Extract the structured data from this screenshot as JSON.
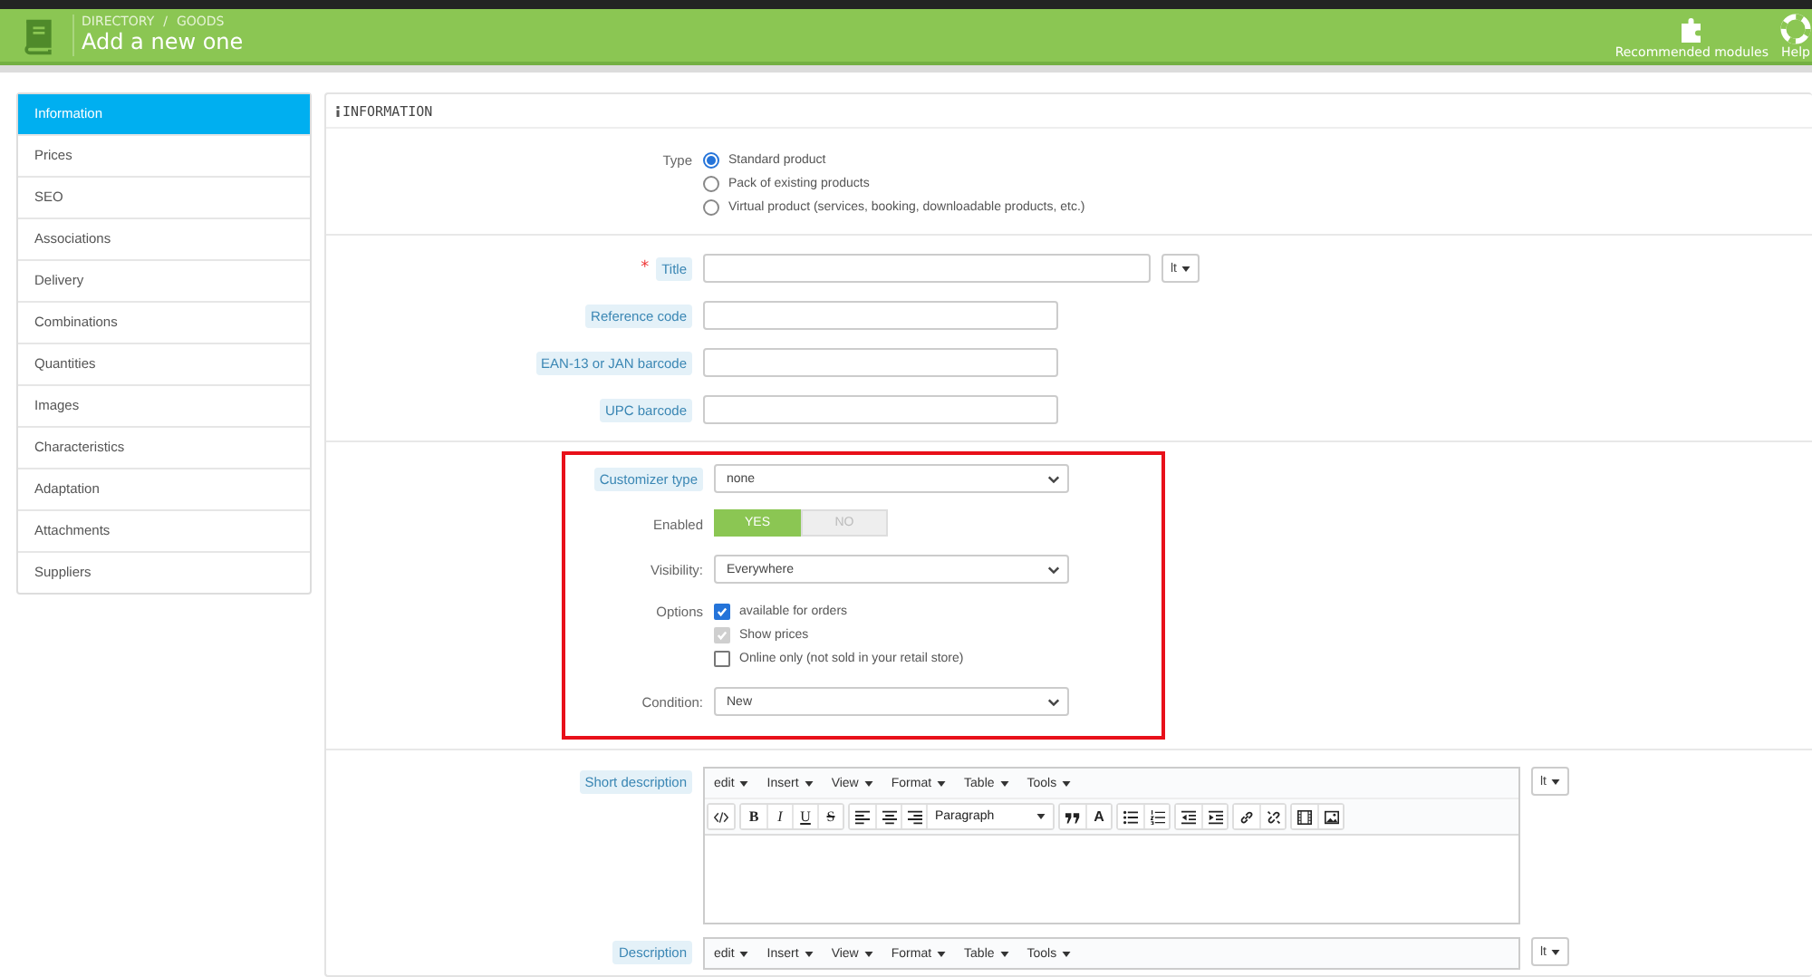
{
  "header": {
    "breadcrumb": [
      "DIRECTORY",
      "GOODS"
    ],
    "separator": "/",
    "title": "Add a new one",
    "actions": [
      {
        "label": "Recommended modules"
      },
      {
        "label": "Help"
      }
    ]
  },
  "sidebar": {
    "items": [
      {
        "label": "Information",
        "selected": true
      },
      {
        "label": "Prices",
        "selected": false
      },
      {
        "label": "SEO",
        "selected": false
      },
      {
        "label": "Associations",
        "selected": false
      },
      {
        "label": "Delivery",
        "selected": false
      },
      {
        "label": "Combinations",
        "selected": false
      },
      {
        "label": "Quantities",
        "selected": false
      },
      {
        "label": "Images",
        "selected": false
      },
      {
        "label": "Characteristics",
        "selected": false
      },
      {
        "label": "Adaptation",
        "selected": false
      },
      {
        "label": "Attachments",
        "selected": false
      },
      {
        "label": "Suppliers",
        "selected": false
      }
    ]
  },
  "panel": {
    "title": "INFORMATION",
    "sections": [
      {
        "highlighted": false,
        "rows": [
          {
            "kind": "radio",
            "label": "Type",
            "hint": false,
            "options": [
              {
                "label": "Standard product",
                "selected": true
              },
              {
                "label": "Pack of existing products",
                "selected": false
              },
              {
                "label": "Virtual product (services, booking, downloadable products, etc.)",
                "selected": false
              }
            ]
          }
        ]
      },
      {
        "highlighted": false,
        "rows": [
          {
            "kind": "input",
            "label": "Title",
            "marker": "*",
            "hint": true,
            "lang": "lt"
          },
          {
            "kind": "input",
            "label": "Reference code",
            "hint": true
          },
          {
            "kind": "input",
            "label": "EAN-13 or JAN barcode",
            "hint": true
          },
          {
            "kind": "input",
            "label": "UPC barcode",
            "hint": true
          }
        ]
      },
      {
        "highlighted": true,
        "rows": [
          {
            "kind": "select",
            "label": "Customizer type",
            "hint": true,
            "value": "none"
          },
          {
            "kind": "switch",
            "label": "Enabled",
            "hint": false,
            "options": [
              {
                "label": "YES",
                "selected": true
              },
              {
                "label": "NO",
                "selected": false
              }
            ]
          },
          {
            "kind": "select",
            "label": "Visibility:",
            "hint": false,
            "value": "Everywhere"
          },
          {
            "kind": "checkbox",
            "label": "Options",
            "hint": false,
            "options": [
              {
                "label": "available for orders",
                "checked": true,
                "disabled": false
              },
              {
                "label": "Show prices",
                "checked": true,
                "disabled": true
              },
              {
                "label": "Online only (not sold in your retail store)",
                "checked": false,
                "disabled": false
              }
            ]
          },
          {
            "kind": "select",
            "label": "Condition:",
            "hint": false,
            "value": "New"
          }
        ]
      },
      {
        "highlighted": false,
        "rows": [
          {
            "kind": "editor",
            "label": "Short description",
            "hint": true,
            "lang": "lt",
            "menu": [
              "edit",
              "Insert",
              "View",
              "Format",
              "Table",
              "Tools"
            ],
            "toolbar": [
              [
                {
                  "kind": "icon"
                }
              ],
              [
                {
                  "kind": "bold",
                  "label": "B"
                },
                {
                  "kind": "italic",
                  "label": "I"
                },
                {
                  "kind": "underline",
                  "label": "U"
                },
                {
                  "kind": "strike",
                  "label": "S"
                }
              ],
              [
                {
                  "kind": "icon"
                },
                {
                  "kind": "icon"
                },
                {
                  "kind": "icon"
                },
                {
                  "kind": "dropdown",
                  "label": "Paragraph"
                }
              ],
              [
                {
                  "kind": "icon"
                },
                {
                  "kind": "color",
                  "label": "A"
                }
              ],
              [
                {
                  "kind": "icon"
                },
                {
                  "kind": "icon"
                }
              ],
              [
                {
                  "kind": "icon"
                },
                {
                  "kind": "icon"
                }
              ],
              [
                {
                  "kind": "icon"
                },
                {
                  "kind": "icon"
                }
              ],
              [
                {
                  "kind": "icon"
                },
                {
                  "kind": "icon"
                }
              ]
            ]
          },
          {
            "kind": "editor",
            "label": "Description",
            "hint": true,
            "lang": "lt",
            "menu": [
              "edit",
              "Insert",
              "View",
              "Format",
              "Table",
              "Tools"
            ]
          }
        ]
      }
    ]
  }
}
